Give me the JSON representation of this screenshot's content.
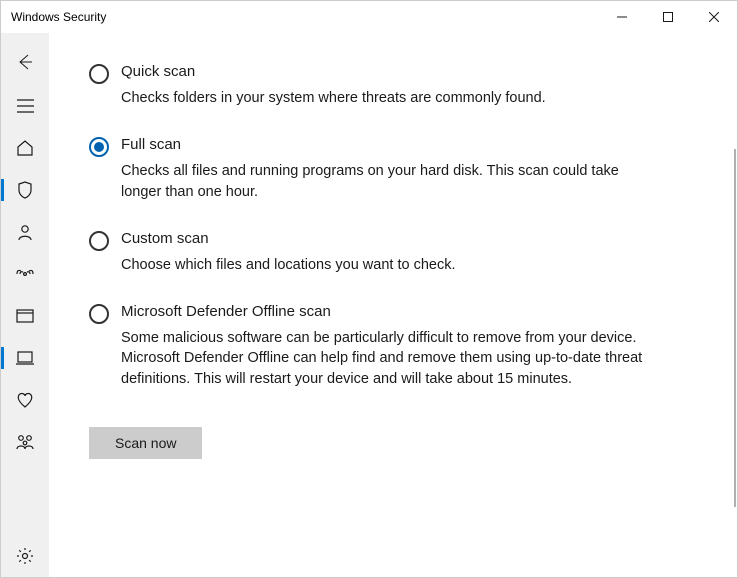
{
  "window": {
    "title": "Windows Security"
  },
  "sidebar": {
    "items": [
      {
        "id": "back",
        "selected": false
      },
      {
        "id": "menu",
        "selected": false
      },
      {
        "id": "home",
        "selected": false
      },
      {
        "id": "virus",
        "selected": true
      },
      {
        "id": "account",
        "selected": false
      },
      {
        "id": "firewall",
        "selected": false
      },
      {
        "id": "app-browser",
        "selected": false
      },
      {
        "id": "device-security",
        "selected": true
      },
      {
        "id": "device-health",
        "selected": false
      },
      {
        "id": "family",
        "selected": false
      },
      {
        "id": "settings",
        "selected": false
      }
    ]
  },
  "scanOptions": {
    "items": [
      {
        "key": "quick",
        "title": "Quick scan",
        "description": "Checks folders in your system where threats are commonly found.",
        "checked": false
      },
      {
        "key": "full",
        "title": "Full scan",
        "description": "Checks all files and running programs on your hard disk. This scan could take longer than one hour.",
        "checked": true
      },
      {
        "key": "custom",
        "title": "Custom scan",
        "description": "Choose which files and locations you want to check.",
        "checked": false
      },
      {
        "key": "offline",
        "title": "Microsoft Defender Offline scan",
        "description": "Some malicious software can be particularly difficult to remove from your device. Microsoft Defender Offline can help find and remove them using up-to-date threat definitions. This will restart your device and will take about 15 minutes.",
        "checked": false
      }
    ],
    "button": "Scan now"
  }
}
